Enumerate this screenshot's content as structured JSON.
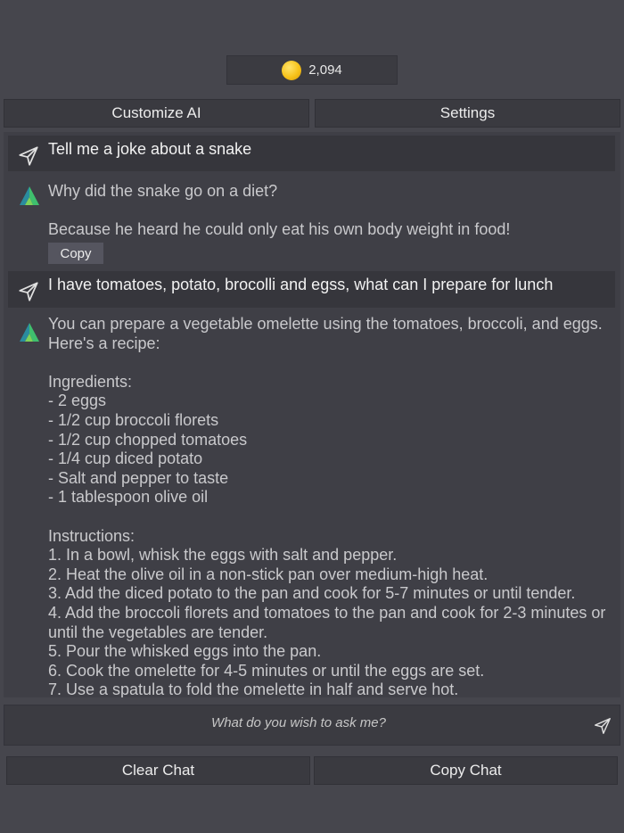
{
  "coins": {
    "amount": "2,094",
    "icon": "coin-icon"
  },
  "top_buttons": {
    "customize": "Customize AI",
    "settings": "Settings"
  },
  "messages": [
    {
      "role": "user",
      "text": "Tell me a joke about a snake"
    },
    {
      "role": "ai",
      "text": "Why did the snake go on a diet?\n\nBecause he heard he could only eat his own body weight in food!",
      "copy_label": "Copy"
    },
    {
      "role": "user",
      "text": "I have tomatoes, potato, brocolli and egss, what can I prepare for lunch"
    },
    {
      "role": "ai",
      "text": "You can prepare a vegetable omelette using the tomatoes, broccoli, and eggs. Here's a recipe:\n\nIngredients:\n- 2 eggs\n- 1/2 cup broccoli florets\n- 1/2 cup chopped tomatoes\n- 1/4 cup diced potato\n- Salt and pepper to taste\n- 1 tablespoon olive oil\n\nInstructions:\n1. In a bowl, whisk the eggs with salt and pepper.\n2. Heat the olive oil in a non-stick pan over medium-high heat.\n3. Add the diced potato to the pan and cook for 5-7 minutes or until tender.\n4. Add the broccoli florets and tomatoes to the pan and cook for 2-3 minutes or until the vegetables are tender.\n5. Pour the whisked eggs into the pan.\n6. Cook the omelette for 4-5 minutes or until the eggs are set.\n7. Use a spatula to fold the omelette in half and serve hot."
    }
  ],
  "input": {
    "placeholder": "What do you wish to ask me?"
  },
  "bottom_buttons": {
    "clear": "Clear Chat",
    "copy": "Copy Chat"
  },
  "colors": {
    "background": "#46464d",
    "panel": "#3f3f46",
    "user_bubble": "#36363c",
    "coin": "#f6c21a"
  }
}
